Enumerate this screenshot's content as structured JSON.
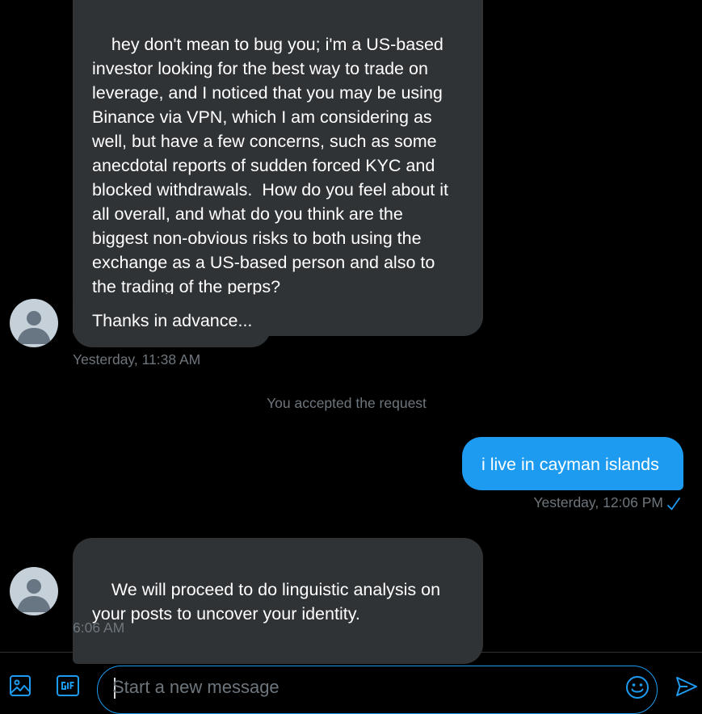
{
  "conversation": {
    "messages": [
      {
        "direction": "incoming",
        "text": "hey don't mean to bug you; i'm a US-based investor looking for the best way to trade on leverage, and I noticed that you may be using Binance via VPN, which I am considering as well, but have a few concerns, such as some anecdotal reports of sudden forced KYC and blocked withdrawals.  How do you feel about it all overall, and what do you think are the biggest non-obvious risks to both using the exchange as a US-based person and also to the trading of the perps?"
      },
      {
        "direction": "incoming",
        "text": "Thanks in advance...",
        "timestamp": "Yesterday, 11:38 AM"
      },
      {
        "direction": "outgoing",
        "text": "i live in cayman islands",
        "timestamp": "Yesterday, 12:06 PM"
      },
      {
        "direction": "incoming",
        "text": "We will proceed to do linguistic analysis on your posts to uncover your identity.",
        "timestamp": "6:06 AM"
      }
    ],
    "system_note": "You accepted the request"
  },
  "composer": {
    "placeholder": "Start a new message",
    "value": "",
    "icons": {
      "image": "image-icon",
      "gif": "gif-icon",
      "emoji": "emoji-icon",
      "send": "send-icon"
    }
  },
  "colors": {
    "background": "#000000",
    "incoming_bubble": "#2f3336",
    "outgoing_bubble": "#1d9bf0",
    "muted_text": "#6e767d",
    "accent": "#1d9bf0"
  }
}
